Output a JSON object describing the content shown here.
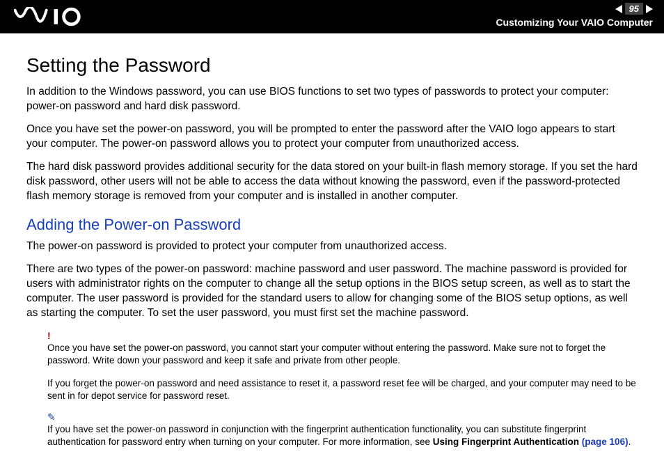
{
  "header": {
    "page_number": "95",
    "breadcrumb": "Customizing Your VAIO Computer"
  },
  "main": {
    "title": "Setting the Password",
    "paragraphs": [
      "In addition to the Windows password, you can use BIOS functions to set two types of passwords to protect your computer: power-on password and hard disk password.",
      "Once you have set the power-on password, you will be prompted to enter the password after the VAIO logo appears to start your computer. The power-on password allows you to protect your computer from unauthorized access.",
      "The hard disk password provides additional security for the data stored on your built-in flash memory storage. If you set the hard disk password, other users will not be able to access the data without knowing the password, even if the password-protected flash memory storage is removed from your computer and is installed in another computer."
    ],
    "subheading": "Adding the Power-on Password",
    "sub_paragraphs": [
      "The power-on password is provided to protect your computer from unauthorized access.",
      "There are two types of the power-on password: machine password and user password. The machine password is provided for users with administrator rights on the computer to change all the setup options in the BIOS setup screen, as well as to start the computer. The user password is provided for the standard users to allow for changing some of the BIOS setup options, as well as starting the computer. To set the user password, you must first set the machine password."
    ],
    "warning_icon": "!",
    "warning_notes": [
      "Once you have set the power-on password, you cannot start your computer without entering the password. Make sure not to forget the password. Write down your password and keep it safe and private from other people.",
      "If you forget the power-on password and need assistance to reset it, a password reset fee will be charged, and your computer may need to be sent in for depot service for password reset."
    ],
    "info_icon": "✎",
    "info_note_prefix": "If you have set the power-on password in conjunction with the fingerprint authentication functionality, you can substitute fingerprint authentication for password entry when turning on your computer. For more information, see ",
    "info_note_bold": "Using Fingerprint Authentication ",
    "info_note_link": "(page 106)",
    "info_note_suffix": "."
  }
}
